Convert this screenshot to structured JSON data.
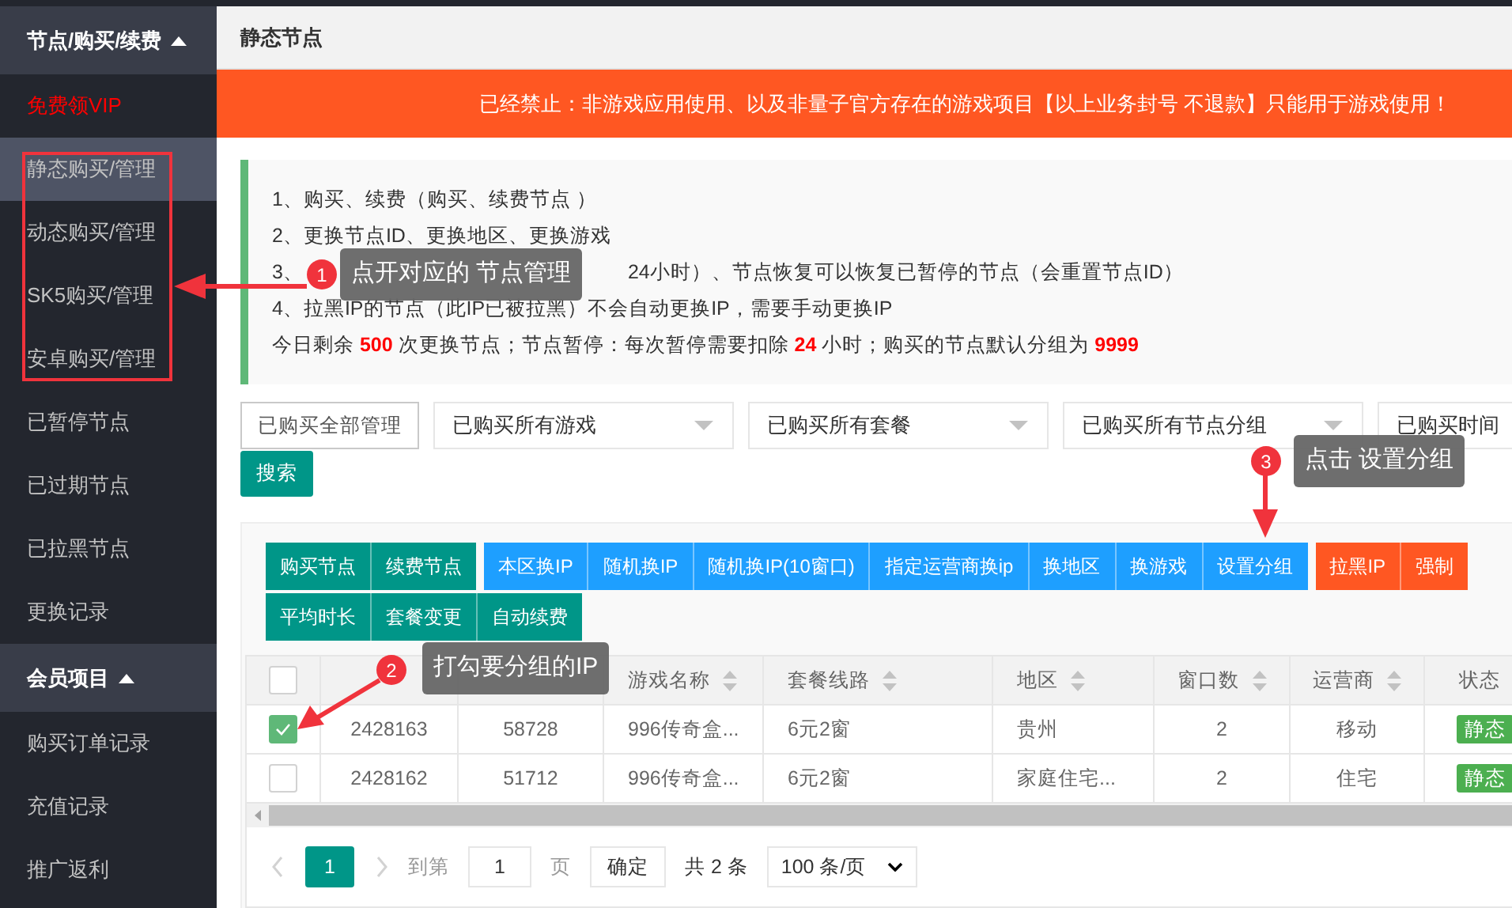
{
  "sidebar": {
    "groups": [
      {
        "title": "节点/购买/续费",
        "expanded": true,
        "items": [
          {
            "label": "免费领VIP",
            "kind": "promo",
            "selected": false
          },
          {
            "label": "静态购买/管理",
            "kind": "normal",
            "selected": true
          },
          {
            "label": "动态购买/管理",
            "kind": "normal",
            "selected": false
          },
          {
            "label": "SK5购买/管理",
            "kind": "normal",
            "selected": false
          },
          {
            "label": "安卓购买/管理",
            "kind": "normal",
            "selected": false
          },
          {
            "label": "已暂停节点",
            "kind": "normal",
            "selected": false
          },
          {
            "label": "已过期节点",
            "kind": "normal",
            "selected": false
          },
          {
            "label": "已拉黑节点",
            "kind": "normal",
            "selected": false
          },
          {
            "label": "更换记录",
            "kind": "normal",
            "selected": false
          }
        ]
      },
      {
        "title": "会员项目",
        "expanded": true,
        "items": [
          {
            "label": "购买订单记录",
            "kind": "normal",
            "selected": false
          },
          {
            "label": "充值记录",
            "kind": "normal",
            "selected": false
          },
          {
            "label": "推广返利",
            "kind": "normal",
            "selected": false
          }
        ]
      }
    ]
  },
  "page_title": "静态节点",
  "banner": "已经禁止：非游戏应用使用、以及非量子官方存在的游戏项目【以上业务封号 不退款】只能用于游戏使用！",
  "notice": {
    "lines": [
      {
        "text": "1、购买、续费（购买、续费节点 ）"
      },
      {
        "text": "2、更换节点ID、更换地区、更换游戏"
      },
      {
        "parts": [
          "3、",
          "24小时）、节点恢复可以恢复已暂停的节点（会重置节点ID）"
        ]
      },
      {
        "text": "4、拉黑IP的节点（此IP已被拉黑）不会自动更换IP，需要手动更换IP"
      },
      {
        "text": "今日剩余 **500** 次更换节点；节点暂停：每次暂停需要扣除 **24** 小时；购买的节点默认分组为 **9999**"
      }
    ]
  },
  "filters": {
    "manage_button": "已购买全部管理",
    "selects": [
      "已购买所有游戏",
      "已购买所有套餐",
      "已购买所有节点分组",
      "已购买时间"
    ],
    "search_button": "搜索"
  },
  "toolbar": [
    [
      {
        "label": "购买节点",
        "color": "#009688"
      },
      {
        "label": "续费节点",
        "color": "#009688"
      },
      {
        "label": "本区换IP",
        "color": "#1e9fff"
      },
      {
        "label": "随机换IP",
        "color": "#1e9fff"
      },
      {
        "label": "随机换IP(10窗口)",
        "color": "#1e9fff"
      },
      {
        "label": "指定运营商换ip",
        "color": "#1e9fff"
      },
      {
        "label": "换地区",
        "color": "#1e9fff"
      },
      {
        "label": "换游戏",
        "color": "#1e9fff"
      },
      {
        "label": "设置分组",
        "color": "#1e9fff"
      },
      {
        "label": "拉黑IP",
        "color": "#ff5722"
      },
      {
        "label": "强制",
        "color": "#ff5722"
      }
    ],
    [
      {
        "label": "平均时长",
        "color": "#009688"
      },
      {
        "label": "套餐变更",
        "color": "#009688"
      },
      {
        "label": "自动续费",
        "color": "#009688"
      }
    ]
  ],
  "table": {
    "all_checked": false,
    "columns": [
      null,
      null,
      {
        "label": "游戏名称",
        "sortable": true
      },
      {
        "label": "套餐线路",
        "sortable": true
      },
      {
        "label": "地区",
        "sortable": true
      },
      {
        "label": "窗口数",
        "sortable": true
      },
      {
        "label": "运营商",
        "sortable": true
      },
      {
        "label": "状态",
        "sortable": false
      }
    ],
    "rows": [
      {
        "checked": true,
        "cells": [
          "2428163",
          "58728",
          "996传奇盒...",
          "6元2窗",
          "贵州",
          "2",
          "移动"
        ],
        "status": "静态"
      },
      {
        "checked": false,
        "cells": [
          "2428162",
          "51712",
          "996传奇盒...",
          "6元2窗",
          "家庭住宅...",
          "2",
          "住宅"
        ],
        "status": "静态"
      }
    ]
  },
  "pagination": {
    "current": "1",
    "goto_label": "到第",
    "page_input": "1",
    "page_unit": "页",
    "confirm": "确定",
    "total": "共 2 条",
    "page_size": "100 条/页"
  },
  "annotations": [
    {
      "number": "1",
      "text": "点开对应的 节点管理"
    },
    {
      "number": "2",
      "text": "打勾要分组的IP"
    },
    {
      "number": "3",
      "text": "点击 设置分组"
    }
  ]
}
